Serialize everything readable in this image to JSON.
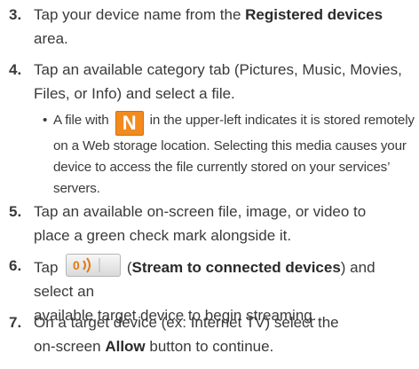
{
  "steps": [
    {
      "number": "3.",
      "line1_before": "Tap your device name from the ",
      "line1_bold": "Registered devices",
      "line2": "area."
    },
    {
      "number": "4.",
      "line1": "Tap an available category tab (Pictures, Music, Movies,",
      "line2": "Files, or Info) and select a file."
    },
    {
      "number": "5.",
      "line1": "Tap an available on-screen file, image, or video to",
      "line2": "place a green check mark alongside it."
    },
    {
      "number": "6.",
      "line1_before": "Tap ",
      "line1_paren_open": " (",
      "line1_bold": "Stream to connected devices",
      "line1_after": ") and select an",
      "line2": "available target device to begin streaming."
    },
    {
      "number": "7.",
      "line1": "On a target device (ex: Internet TV) select the",
      "line2_before": "on-screen ",
      "line2_bold": "Allow",
      "line2_after": " button to continue."
    }
  ],
  "bullet": {
    "symbol": "•",
    "line1_before": "A file with ",
    "icon_letter": "N",
    "line1_after": " in the upper-left indicates it is stored remotely",
    "line2": "on a Web storage location. Selecting this media causes your",
    "line3": "device to access the file currently stored on your services’",
    "line4": "servers."
  },
  "icons": {
    "n_icon": {
      "name": "web-storage-n-icon",
      "color": "#f28a1e"
    },
    "stream_icon": {
      "name": "stream-to-devices-icon",
      "color": "#e07a12"
    }
  }
}
